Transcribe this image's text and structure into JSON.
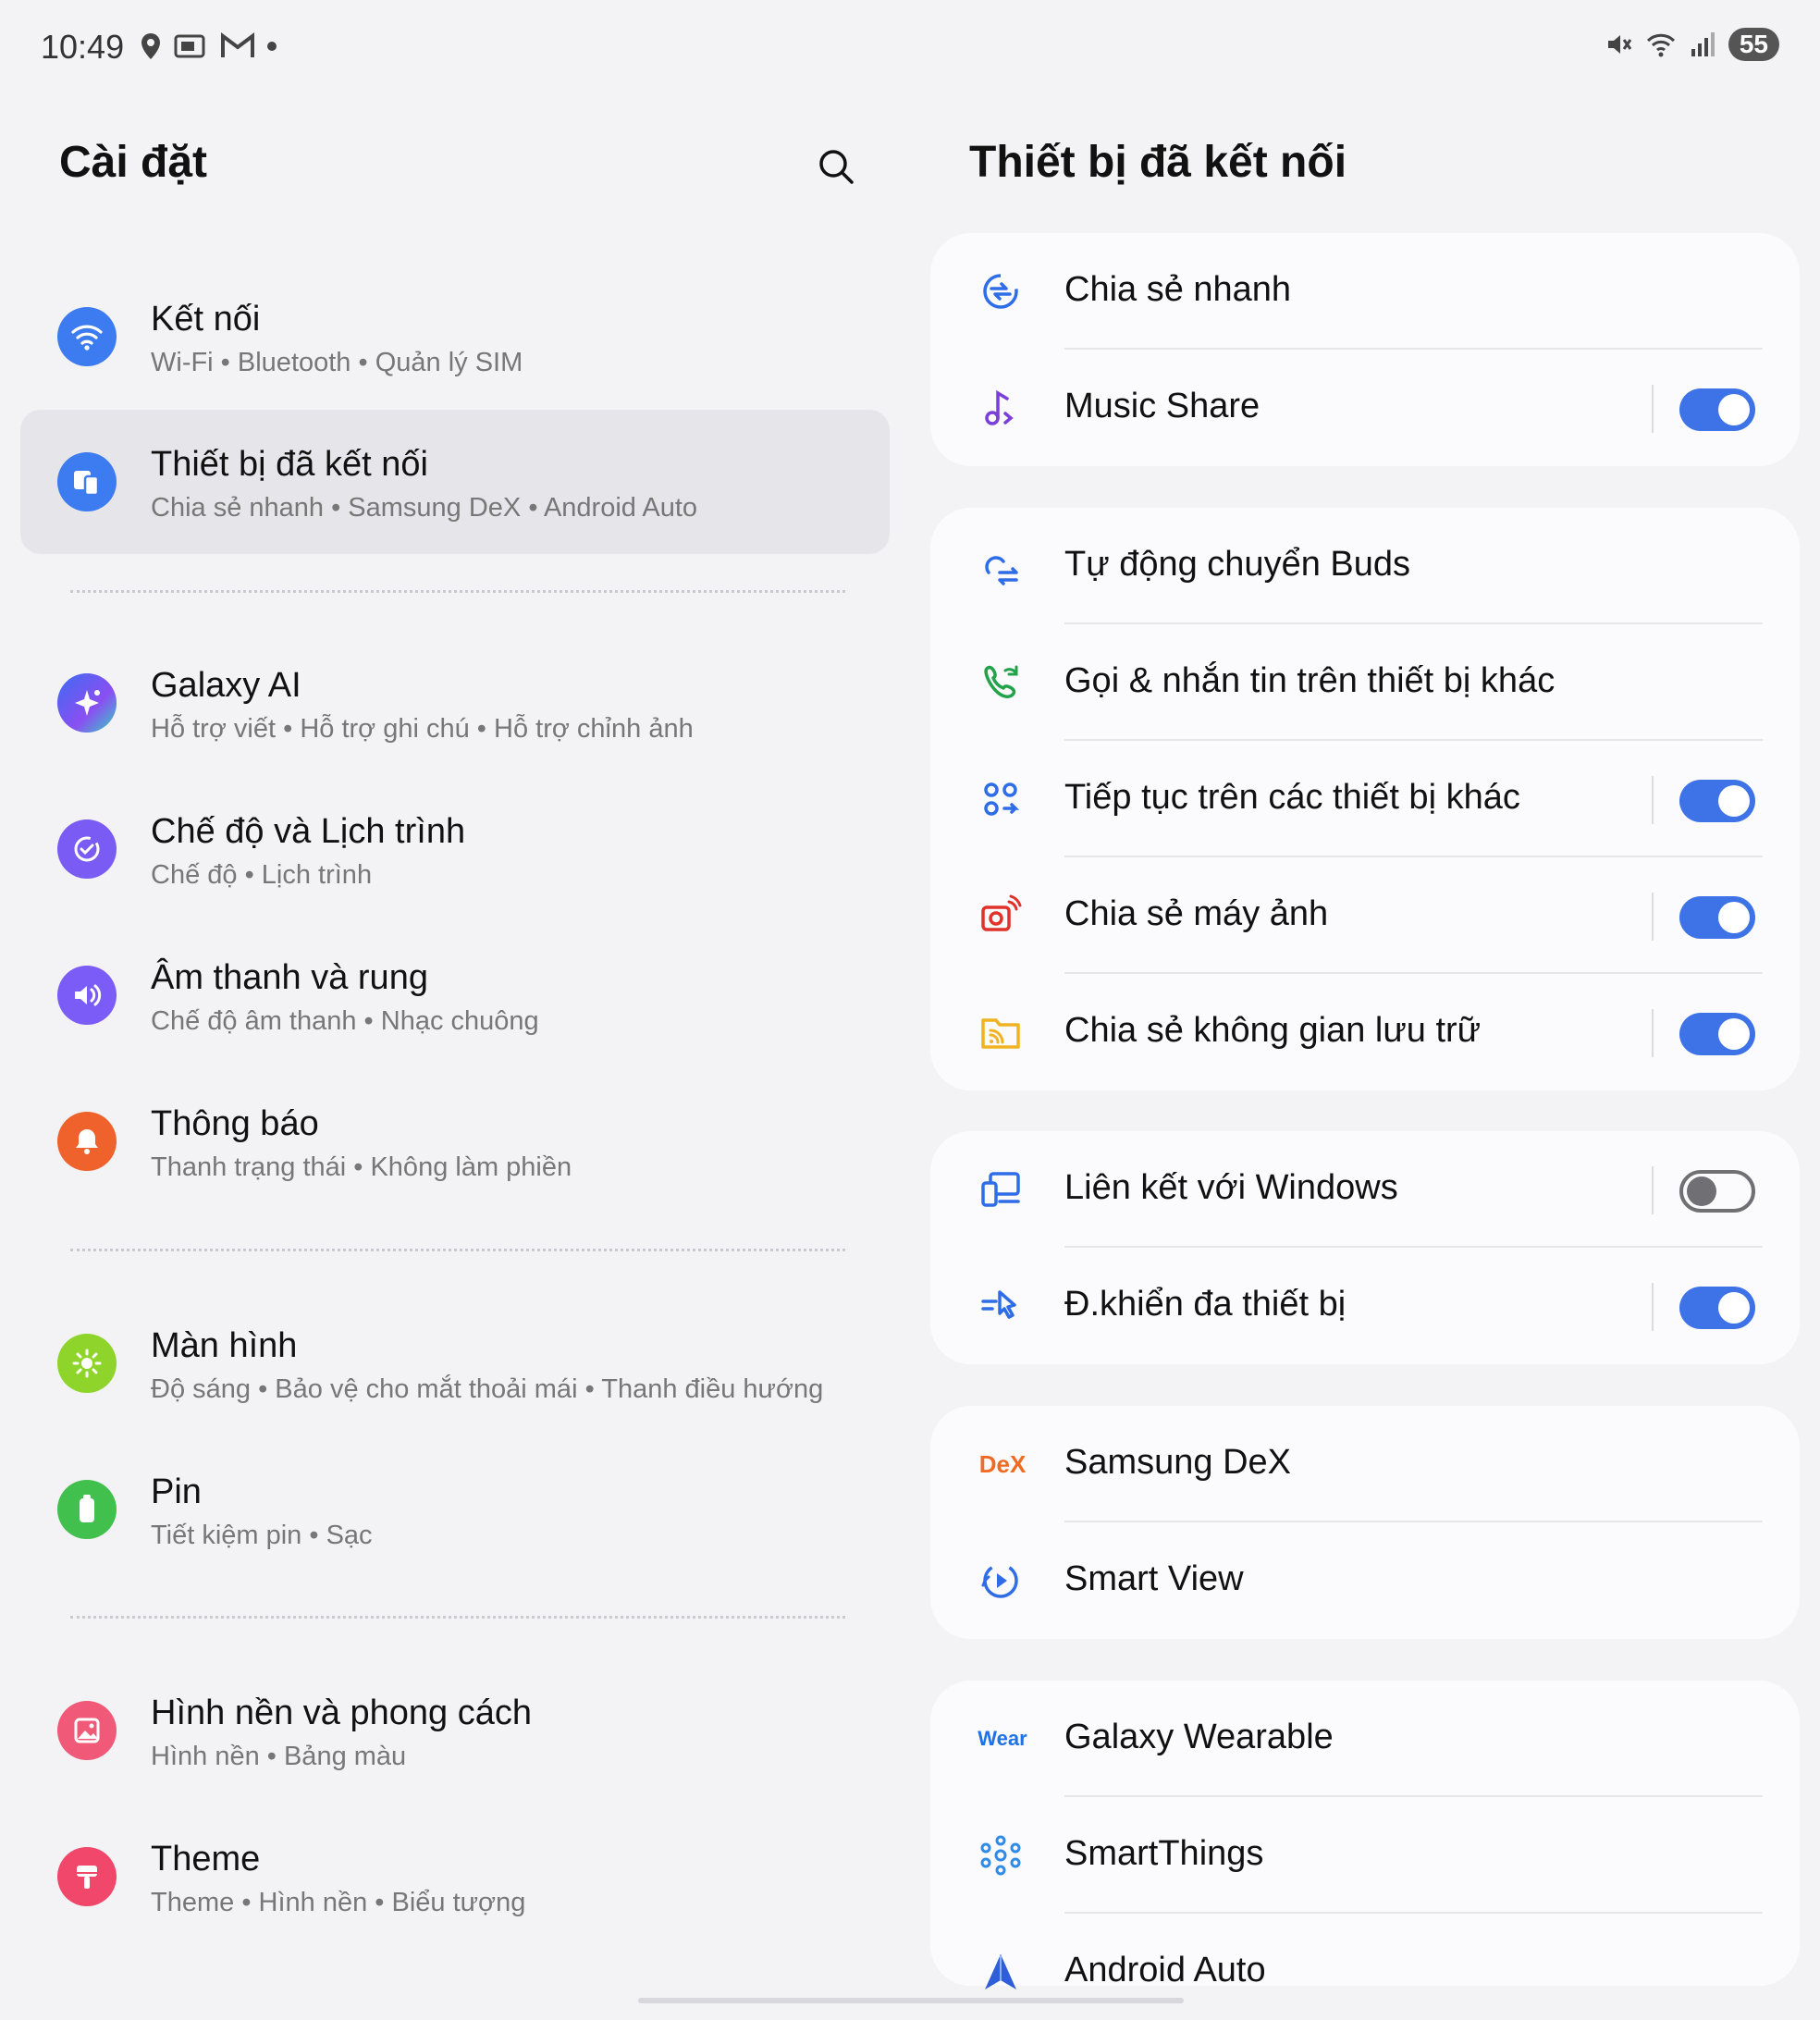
{
  "status_bar": {
    "time": "10:49",
    "left_icons": [
      "location-icon",
      "cast-icon",
      "gmail-icon",
      "dot-icon"
    ],
    "right_icons": [
      "mute-icon",
      "wifi-icon",
      "signal-icon"
    ],
    "battery": "55"
  },
  "left": {
    "title": "Cài đặt",
    "items": [
      {
        "title": "Kết nối",
        "sub": "Wi-Fi  •  Bluetooth  •  Quản lý SIM",
        "icon": "wifi-icon",
        "color": "#3d7bf0"
      },
      {
        "title": "Thiết bị đã kết nối",
        "sub": "Chia sẻ nhanh  •  Samsung DeX  •  Android Auto",
        "icon": "devices-icon",
        "color": "#3d7bf0",
        "selected": true
      },
      {
        "title": "Galaxy AI",
        "sub": "Hỗ trợ viết  •  Hỗ trợ ghi chú  •  Hỗ trợ chỉnh ảnh",
        "icon": "sparkle-icon",
        "color": "#5b5ff0"
      },
      {
        "title": "Chế độ và Lịch trình",
        "sub": "Chế độ  •  Lịch trình",
        "icon": "check-circle-icon",
        "color": "#7a5cf5"
      },
      {
        "title": "Âm thanh và rung",
        "sub": "Chế độ âm thanh  •  Nhạc chuông",
        "icon": "volume-icon",
        "color": "#7b5cf6"
      },
      {
        "title": "Thông báo",
        "sub": "Thanh trạng thái  •  Không làm phiền",
        "icon": "bell-icon",
        "color": "#f0622c"
      },
      {
        "title": "Màn hình",
        "sub": "Độ sáng  •  Bảo vệ cho mắt thoải mái  •  Thanh điều hướng",
        "icon": "sun-icon",
        "color": "#8fd42b"
      },
      {
        "title": "Pin",
        "sub": "Tiết kiệm pin  •  Sạc",
        "icon": "battery-icon",
        "color": "#41c04d"
      },
      {
        "title": "Hình nền và phong cách",
        "sub": "Hình nền  •  Bảng màu",
        "icon": "image-icon",
        "color": "#f05a78"
      },
      {
        "title": "Theme",
        "sub": "Theme  •  Hình nền  •  Biểu tượng",
        "icon": "brush-icon",
        "color": "#f0476a"
      }
    ]
  },
  "right": {
    "title": "Thiết bị đã kết nối",
    "cards": [
      {
        "rows": [
          {
            "label": "Chia sẻ nhanh",
            "icon": "quick-share-icon"
          },
          {
            "label": "Music Share",
            "icon": "music-share-icon",
            "toggle": true,
            "on": true
          }
        ]
      },
      {
        "rows": [
          {
            "label": "Tự động chuyển Buds",
            "icon": "buds-switch-icon"
          },
          {
            "label": "Gọi & nhắn tin trên thiết bị khác",
            "icon": "call-other-devices-icon"
          },
          {
            "label": "Tiếp tục trên các thiết bị khác",
            "icon": "continue-apps-icon",
            "toggle": true,
            "on": true
          },
          {
            "label": "Chia sẻ máy ảnh",
            "icon": "camera-share-icon",
            "toggle": true,
            "on": true
          },
          {
            "label": "Chia sẻ không gian lưu trữ",
            "icon": "storage-share-icon",
            "toggle": true,
            "on": true
          }
        ]
      },
      {
        "rows": [
          {
            "label": "Liên kết với Windows",
            "icon": "link-windows-icon",
            "toggle": true,
            "on": false
          },
          {
            "label": "Đ.khiển đa thiết bị",
            "icon": "multi-control-icon",
            "toggle": true,
            "on": true
          }
        ]
      },
      {
        "rows": [
          {
            "label": "Samsung DeX",
            "icon": "dex-icon",
            "brand": "DeX"
          },
          {
            "label": "Smart View",
            "icon": "smart-view-icon"
          }
        ]
      },
      {
        "rows": [
          {
            "label": "Galaxy Wearable",
            "icon": "wear-icon",
            "brand": "Wear"
          },
          {
            "label": "SmartThings",
            "icon": "smartthings-icon"
          },
          {
            "label": "Android Auto",
            "icon": "android-auto-icon"
          }
        ]
      }
    ]
  }
}
